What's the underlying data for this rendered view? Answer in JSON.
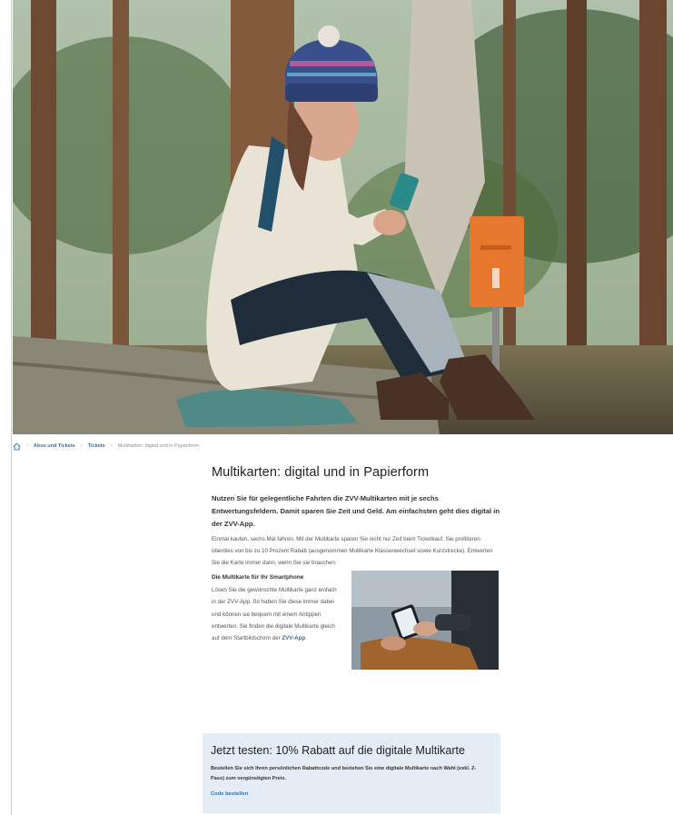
{
  "breadcrumb": {
    "items": [
      "Abos und Tickets",
      "Tickets"
    ],
    "current": "Multikarten: digital und in Papierform"
  },
  "article": {
    "title": "Multikarten: digital und in Papierform",
    "lead": "Nutzen Sie für gelegentliche Fahrten die ZVV-Multikarten mit je sechs Entwertungsfeldern. Damit sparen Sie Zeit und Geld. Am einfachsten geht dies digital in der ZVV-App.",
    "body": "Einmal kaufen, sechs Mal fahren. Mit der Multikarte sparen Sie nicht nur Zeit beim Ticketkauf. Sie profitieren überdies von bis zu 10 Prozent Rabatt (ausgenommen Multikarte Klassenwechsel sowie Kurzstrecke). Entwerten Sie die Karte immer dann, wenn Sie sie brauchen.",
    "subheading": "Die Multikarte für Ihr Smartphone",
    "smartphone_text": "Lösen Sie die gewünschte Multikarte ganz einfach in der ZVV-App. So haben Sie diese immer dabei und können sie bequem mit einem Antippen entwerten. Sie finden die digitale Multikarte gleich auf dem Startbildschirm der",
    "app_link": "ZVV-App",
    "app_link_suffix": "."
  },
  "promo": {
    "title": "Jetzt testen: 10% Rabatt auf die digitale Multikarte",
    "text": "Bestellen Sie sich Ihren persönlichen Rabattcode und beziehen Sie eine digitale Multikarte nach Wahl (exkl. Z-Pass) zum vergünstigten Preis.",
    "link": "Code bestellen"
  },
  "colors": {
    "link": "#2f6fb3",
    "promo_bg": "#e4edf6",
    "ticket_machine": "#e8772e"
  },
  "icons": {
    "home": "home-icon"
  }
}
